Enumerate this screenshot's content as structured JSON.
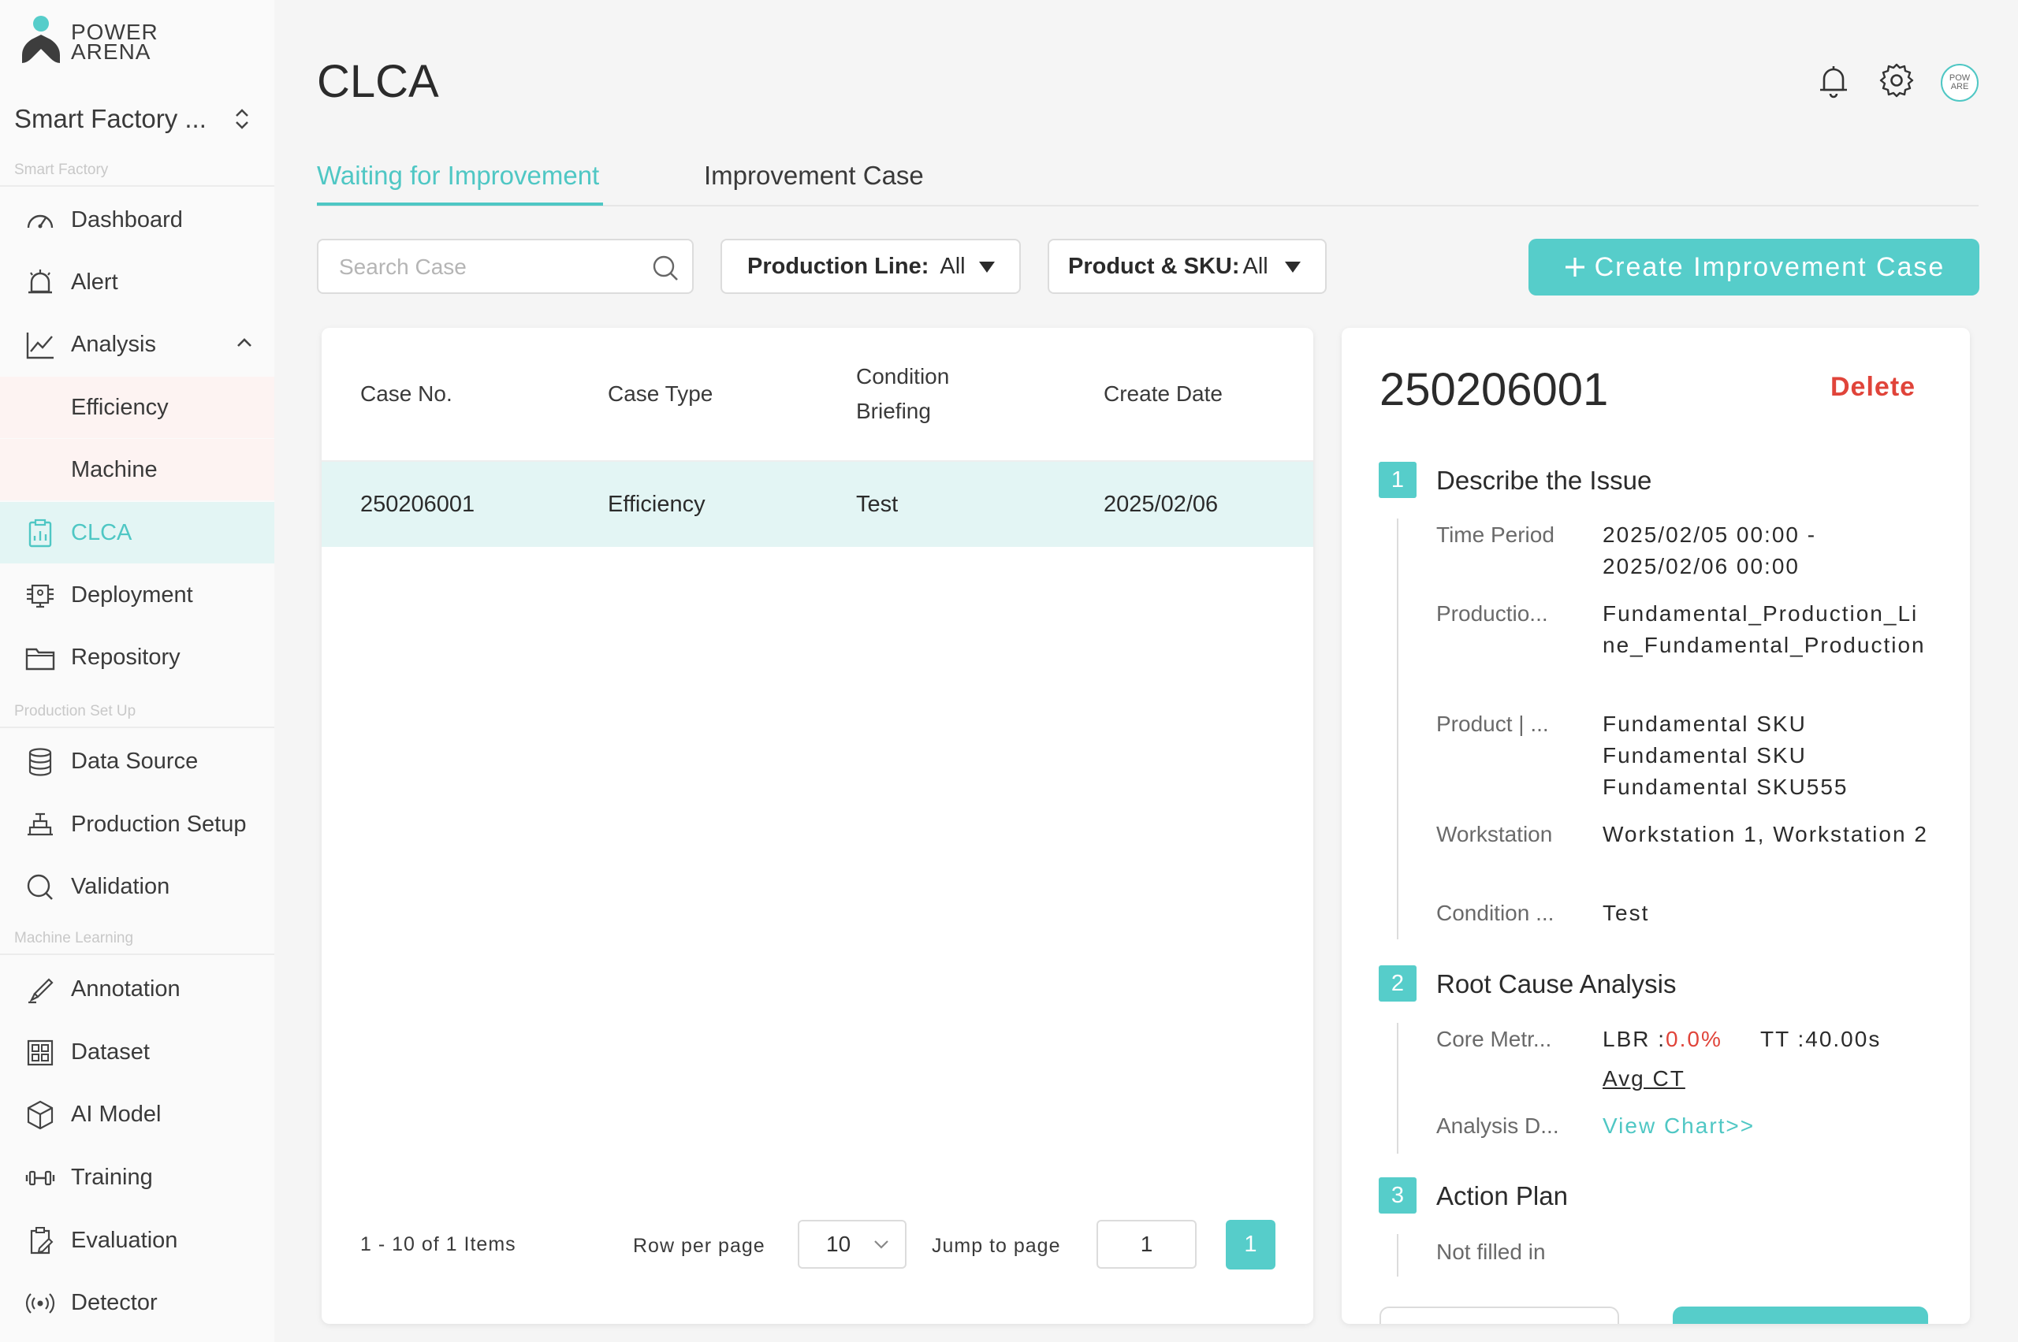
{
  "brand": {
    "logo_line1": "POWER",
    "logo_line2": "ARENA"
  },
  "workspace": {
    "name": "Smart Factory ..."
  },
  "sidebar": {
    "sections": [
      "Smart Factory",
      "Production Set Up",
      "Machine Learning"
    ],
    "items": [
      {
        "label": "Dashboard",
        "icon": "dashboard-icon"
      },
      {
        "label": "Alert",
        "icon": "alert-icon"
      },
      {
        "label": "Analysis",
        "icon": "analysis-icon"
      },
      {
        "label": "Efficiency"
      },
      {
        "label": "Machine"
      },
      {
        "label": "CLCA",
        "icon": "clca-icon"
      },
      {
        "label": "Deployment",
        "icon": "deployment-icon"
      },
      {
        "label": "Repository",
        "icon": "folder-icon"
      },
      {
        "label": "Data Source",
        "icon": "database-icon"
      },
      {
        "label": "Production Setup",
        "icon": "production-setup-icon"
      },
      {
        "label": "Validation",
        "icon": "validation-icon"
      },
      {
        "label": "Annotation",
        "icon": "annotation-icon"
      },
      {
        "label": "Dataset",
        "icon": "dataset-icon"
      },
      {
        "label": "AI Model",
        "icon": "ai-model-icon"
      },
      {
        "label": "Training",
        "icon": "training-icon"
      },
      {
        "label": "Evaluation",
        "icon": "evaluation-icon"
      },
      {
        "label": "Detector",
        "icon": "detector-icon"
      }
    ],
    "active_item": "CLCA"
  },
  "header": {
    "title": "CLCA",
    "avatar_text_1": "POW",
    "avatar_text_2": "ARE"
  },
  "tabs": [
    {
      "label": "Waiting for Improvement",
      "active": true
    },
    {
      "label": "Improvement Case",
      "active": false
    }
  ],
  "filters": {
    "search_placeholder": "Search Case",
    "production_line_label": "Production Line:",
    "production_line_value": "All",
    "product_sku_label": "Product & SKU:",
    "product_sku_value": "All",
    "create_button": "Create Improvement Case"
  },
  "table": {
    "columns": [
      "Case No.",
      "Case Type",
      "Condition",
      "Briefing",
      "Create Date"
    ],
    "rows": [
      {
        "case_no": "250206001",
        "case_type": "Efficiency",
        "condition": "Test",
        "create_date": "2025/02/06"
      }
    ]
  },
  "pagination": {
    "range": "1 - 10 of 1 Items",
    "rows_label": "Row per page",
    "rows_value": "10",
    "jump_label": "Jump to page",
    "jump_value": "1",
    "current_page": "1"
  },
  "detail": {
    "case_id": "250206001",
    "delete_label": "Delete",
    "step1": {
      "num": "1",
      "title": "Describe the Issue",
      "time_period_label": "Time Period",
      "time_period_1": "2025/02/05 00:00 -",
      "time_period_2": "2025/02/06 00:00",
      "production_label": "Productio...",
      "production_value": "Fundamental_Production_Line_Fundamental_Production",
      "product_label": "Product | ...",
      "product_1": "Fundamental SKU",
      "product_2": "Fundamental SKU",
      "product_3": "Fundamental SKU555",
      "workstation_label": "Workstation",
      "workstation_value": "Workstation 1, Workstation 2",
      "condition_label": "Condition ...",
      "condition_value": "Test"
    },
    "step2": {
      "num": "2",
      "title": "Root Cause Analysis",
      "core_label": "Core Metr...",
      "lbr_label": "LBR :",
      "lbr_value": "0.0%",
      "tt": "TT :40.00s",
      "avg_ct": "Avg CT",
      "analysis_label": "Analysis D...",
      "view_chart": "View Chart>>"
    },
    "step3": {
      "num": "3",
      "title": "Action Plan",
      "status": "Not filled in"
    }
  },
  "colors": {
    "accent": "#56cdca",
    "danger": "#e0443a",
    "active_bg": "#e3f5f4"
  }
}
